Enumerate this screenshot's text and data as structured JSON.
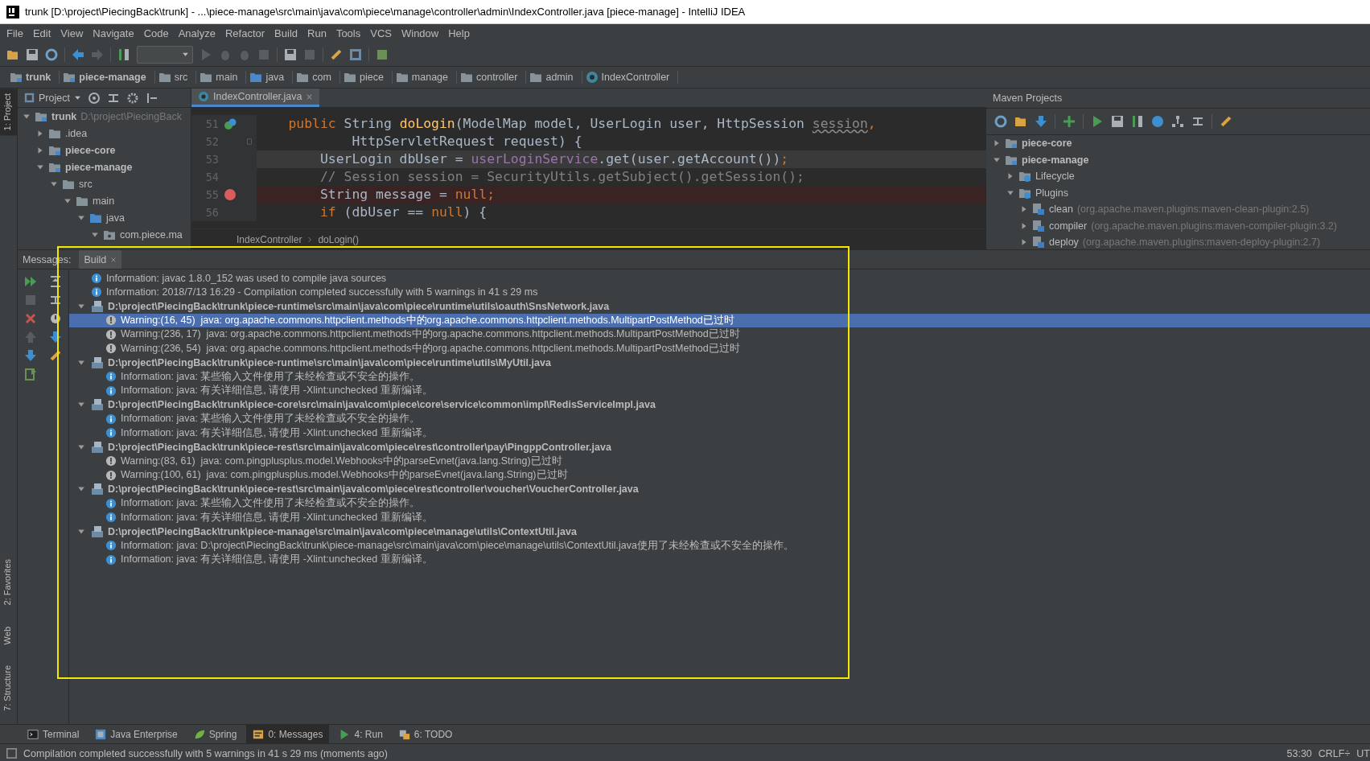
{
  "window": {
    "title": "trunk [D:\\project\\PiecingBack\\trunk] - ...\\piece-manage\\src\\main\\java\\com\\piece\\manage\\controller\\admin\\IndexController.java [piece-manage] - IntelliJ IDEA"
  },
  "menu": [
    "File",
    "Edit",
    "View",
    "Navigate",
    "Code",
    "Analyze",
    "Refactor",
    "Build",
    "Run",
    "Tools",
    "VCS",
    "Window",
    "Help"
  ],
  "breadcrumbs": [
    {
      "label": "trunk",
      "kind": "root"
    },
    {
      "label": "piece-manage",
      "kind": "module"
    },
    {
      "label": "src",
      "kind": "folder"
    },
    {
      "label": "main",
      "kind": "folder"
    },
    {
      "label": "java",
      "kind": "source"
    },
    {
      "label": "com",
      "kind": "folder"
    },
    {
      "label": "piece",
      "kind": "folder"
    },
    {
      "label": "manage",
      "kind": "folder"
    },
    {
      "label": "controller",
      "kind": "folder"
    },
    {
      "label": "admin",
      "kind": "folder"
    },
    {
      "label": "IndexController",
      "kind": "class"
    }
  ],
  "tool_stripe": {
    "top": [
      {
        "label": "1: Project",
        "selected": true
      }
    ],
    "bottom": [
      {
        "label": "2: Favorites",
        "selected": false
      },
      {
        "label": "Web",
        "selected": false
      },
      {
        "label": "7: Structure",
        "selected": false
      }
    ]
  },
  "project_panel": {
    "title": "Project",
    "tree": [
      {
        "label": "trunk",
        "hint": "D:\\project\\PiecingBack",
        "kind": "module",
        "expanded": true,
        "children": [
          {
            "label": ".idea",
            "kind": "folder",
            "expanded": false
          },
          {
            "label": "piece-core",
            "kind": "module",
            "expanded": false
          },
          {
            "label": "piece-manage",
            "kind": "module",
            "expanded": true,
            "children": [
              {
                "label": "src",
                "kind": "folder",
                "expanded": true,
                "children": [
                  {
                    "label": "main",
                    "kind": "folder",
                    "expanded": true,
                    "children": [
                      {
                        "label": "java",
                        "kind": "source",
                        "expanded": true,
                        "children": [
                          {
                            "label": "com.piece.ma",
                            "kind": "package",
                            "expanded": true
                          }
                        ]
                      }
                    ]
                  }
                ]
              }
            ]
          }
        ]
      }
    ]
  },
  "editor": {
    "tab": {
      "label": "IndexController.java",
      "selected": true
    },
    "lines": [
      {
        "number": "51",
        "kind": "override",
        "breakpoint": false,
        "caret": false,
        "tokens": [
          {
            "text": "    public ",
            "kind": "keyword"
          },
          {
            "text": "String ",
            "kind": "plain"
          },
          {
            "text": "doLogin",
            "kind": "method"
          },
          {
            "text": "(ModelMap model, UserLogin user, HttpSession ",
            "kind": "plain"
          },
          {
            "text": "session",
            "kind": "unused"
          },
          {
            "text": ",",
            "kind": "keyword"
          }
        ]
      },
      {
        "number": "52",
        "kind": "fold",
        "breakpoint": false,
        "caret": false,
        "tokens": [
          {
            "text": "            HttpServletRequest request) {",
            "kind": "plain"
          }
        ]
      },
      {
        "number": "53",
        "breakpoint": false,
        "caret": true,
        "tokens": [
          {
            "text": "        UserLogin dbUser = ",
            "kind": "plain"
          },
          {
            "text": "userLoginService",
            "kind": "field"
          },
          {
            "text": ".get(user.getAccount())",
            "kind": "plain"
          },
          {
            "text": ";",
            "kind": "keyword"
          }
        ]
      },
      {
        "number": "54",
        "breakpoint": false,
        "caret": false,
        "tokens": [
          {
            "text": "        // Session session = SecurityUtils.getSubject().getSession();",
            "kind": "comment"
          }
        ]
      },
      {
        "number": "55",
        "breakpoint": true,
        "caret": false,
        "tokens": [
          {
            "text": "        String message = ",
            "kind": "plain"
          },
          {
            "text": "null",
            "kind": "keyword"
          },
          {
            "text": ";",
            "kind": "keyword"
          }
        ]
      },
      {
        "number": "56",
        "breakpoint": false,
        "caret": false,
        "tokens": [
          {
            "text": "        if ",
            "kind": "keyword"
          },
          {
            "text": "(dbUser == ",
            "kind": "plain"
          },
          {
            "text": "null",
            "kind": "keyword"
          },
          {
            "text": ") {",
            "kind": "plain"
          }
        ]
      }
    ],
    "breadcrumb": [
      "IndexController",
      "doLogin()"
    ]
  },
  "maven_panel": {
    "title": "Maven Projects",
    "tree": [
      {
        "label": "piece-core",
        "kind": "module",
        "expanded": false
      },
      {
        "label": "piece-manage",
        "kind": "module",
        "expanded": true,
        "children": [
          {
            "label": "Lifecycle",
            "kind": "group",
            "expanded": false
          },
          {
            "label": "Plugins",
            "kind": "group",
            "expanded": true,
            "children": [
              {
                "label": "clean",
                "hint": "(org.apache.maven.plugins:maven-clean-plugin:2.5)",
                "kind": "plugin",
                "expanded": false
              },
              {
                "label": "compiler",
                "hint": "(org.apache.maven.plugins:maven-compiler-plugin:3.2)",
                "kind": "plugin",
                "expanded": false
              },
              {
                "label": "deploy",
                "hint": "(org.apache.maven.plugins:maven-deploy-plugin:2.7)",
                "kind": "plugin",
                "expanded": false
              }
            ]
          }
        ]
      }
    ]
  },
  "messages": {
    "label": "Messages:",
    "tabs": [
      {
        "label": "Build",
        "selected": true
      }
    ],
    "rows": [
      {
        "kind": "info",
        "selected": false,
        "text": "Information: javac 1.8.0_152 was used to compile java sources"
      },
      {
        "kind": "info",
        "selected": false,
        "text": "Information: 2018/7/13 16:29 - Compilation completed successfully with 5 warnings in 41 s 29 ms"
      },
      {
        "kind": "file",
        "selected": false,
        "expanded": true,
        "text": "D:\\project\\PiecingBack\\trunk\\piece-runtime\\src\\main\\java\\com\\piece\\runtime\\utils\\oauth\\SnsNetwork.java",
        "children": [
          {
            "kind": "warning",
            "selected": true,
            "text": "Warning:(16, 45)  java: org.apache.commons.httpclient.methods中的org.apache.commons.httpclient.methods.MultipartPostMethod已过时"
          },
          {
            "kind": "warning",
            "selected": false,
            "text": "Warning:(236, 17)  java: org.apache.commons.httpclient.methods中的org.apache.commons.httpclient.methods.MultipartPostMethod已过时"
          },
          {
            "kind": "warning",
            "selected": false,
            "text": "Warning:(236, 54)  java: org.apache.commons.httpclient.methods中的org.apache.commons.httpclient.methods.MultipartPostMethod已过时"
          }
        ]
      },
      {
        "kind": "file",
        "selected": false,
        "expanded": true,
        "text": "D:\\project\\PiecingBack\\trunk\\piece-runtime\\src\\main\\java\\com\\piece\\runtime\\utils\\MyUtil.java",
        "children": [
          {
            "kind": "info",
            "selected": false,
            "text": "Information: java: 某些输入文件使用了未经检查或不安全的操作。"
          },
          {
            "kind": "info",
            "selected": false,
            "text": "Information: java: 有关详细信息, 请使用 -Xlint:unchecked 重新编译。"
          }
        ]
      },
      {
        "kind": "file",
        "selected": false,
        "expanded": true,
        "text": "D:\\project\\PiecingBack\\trunk\\piece-core\\src\\main\\java\\com\\piece\\core\\service\\common\\impl\\RedisServiceImpl.java",
        "children": [
          {
            "kind": "info",
            "selected": false,
            "text": "Information: java: 某些输入文件使用了未经检查或不安全的操作。"
          },
          {
            "kind": "info",
            "selected": false,
            "text": "Information: java: 有关详细信息, 请使用 -Xlint:unchecked 重新编译。"
          }
        ]
      },
      {
        "kind": "file",
        "selected": false,
        "expanded": true,
        "text": "D:\\project\\PiecingBack\\trunk\\piece-rest\\src\\main\\java\\com\\piece\\rest\\controller\\pay\\PingppController.java",
        "children": [
          {
            "kind": "warning",
            "selected": false,
            "text": "Warning:(83, 61)  java: com.pingplusplus.model.Webhooks中的parseEvnet(java.lang.String)已过时"
          },
          {
            "kind": "warning",
            "selected": false,
            "text": "Warning:(100, 61)  java: com.pingplusplus.model.Webhooks中的parseEvnet(java.lang.String)已过时"
          }
        ]
      },
      {
        "kind": "file",
        "selected": false,
        "expanded": true,
        "text": "D:\\project\\PiecingBack\\trunk\\piece-rest\\src\\main\\java\\com\\piece\\rest\\controller\\voucher\\VoucherController.java",
        "children": [
          {
            "kind": "info",
            "selected": false,
            "text": "Information: java: 某些输入文件使用了未经检查或不安全的操作。"
          },
          {
            "kind": "info",
            "selected": false,
            "text": "Information: java: 有关详细信息, 请使用 -Xlint:unchecked 重新编译。"
          }
        ]
      },
      {
        "kind": "file",
        "selected": false,
        "expanded": true,
        "text": "D:\\project\\PiecingBack\\trunk\\piece-manage\\src\\main\\java\\com\\piece\\manage\\utils\\ContextUtil.java",
        "children": [
          {
            "kind": "info",
            "selected": false,
            "text": "Information: java: D:\\project\\PiecingBack\\trunk\\piece-manage\\src\\main\\java\\com\\piece\\manage\\utils\\ContextUtil.java使用了未经检查或不安全的操作。"
          },
          {
            "kind": "info",
            "selected": false,
            "text": "Information: java: 有关详细信息, 请使用 -Xlint:unchecked 重新编译。"
          }
        ]
      }
    ]
  },
  "tool_tabs": [
    {
      "label": "Terminal",
      "kind": "terminal",
      "selected": false
    },
    {
      "label": "Java Enterprise",
      "kind": "javaee",
      "selected": false
    },
    {
      "label": "Spring",
      "kind": "spring",
      "selected": false
    },
    {
      "label": "0: Messages",
      "kind": "messages",
      "selected": true
    },
    {
      "label": "4: Run",
      "kind": "run",
      "selected": false
    },
    {
      "label": "6: TODO",
      "kind": "todo",
      "selected": false
    }
  ],
  "status_bar": {
    "text": "Compilation completed successfully with 5 warnings in 41 s 29 ms (moments ago)",
    "position": "53:30",
    "line_separator": "CRLF÷",
    "encoding": "UT"
  }
}
